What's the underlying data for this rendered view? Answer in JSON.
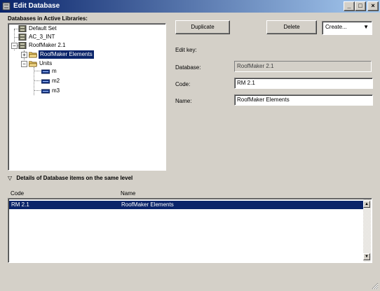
{
  "window": {
    "title": "Edit Database",
    "minimize_glyph": "_",
    "maximize_glyph": "□",
    "close_glyph": "×"
  },
  "tree": {
    "heading": "Databases in Active Libraries:",
    "items": [
      {
        "label": "Default Set"
      },
      {
        "label": "AC_3_INT"
      },
      {
        "label": "RoofMaker 2.1"
      },
      {
        "label": "RoofMaker Elements"
      },
      {
        "label": "Units"
      },
      {
        "label": "m"
      },
      {
        "label": "m2"
      },
      {
        "label": "m3"
      }
    ],
    "expand_glyph": "+",
    "collapse_glyph": "−"
  },
  "toolbar": {
    "duplicate_label": "Duplicate",
    "delete_label": "Delete",
    "create_value": "Create...",
    "create_arrow": "▼"
  },
  "editor": {
    "heading": "Edit key:",
    "database_label": "Database:",
    "database_value": "RoofMaker 2.1",
    "code_label": "Code:",
    "code_value": "RM 2.1",
    "name_label": "Name:",
    "name_value": "RoofMaker Elements"
  },
  "details": {
    "toggle_glyph": "▽",
    "heading": "Details of Database items on the same level",
    "columns": {
      "code": "Code",
      "name": "Name"
    },
    "rows": [
      {
        "code": "RM 2.1",
        "name": "RoofMaker Elements"
      }
    ],
    "scroll_up_glyph": "▲",
    "scroll_down_glyph": "▼"
  },
  "colors": {
    "titlebar_start": "#0a246a",
    "titlebar_end": "#a6caf0",
    "selection": "#0a246a",
    "face": "#d4d0c8"
  }
}
